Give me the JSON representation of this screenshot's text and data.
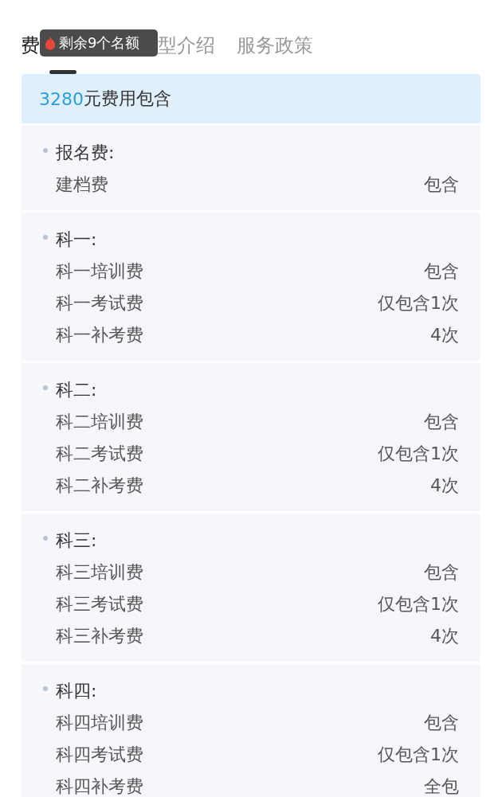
{
  "tabs": [
    {
      "label": "费",
      "selected": true
    },
    {
      "label": "型介绍",
      "selected": false
    },
    {
      "label": "服务政策",
      "selected": false
    }
  ],
  "tooltip": {
    "text": "剩余9个名额"
  },
  "summary": {
    "amount": "3280",
    "text": "元费用包含"
  },
  "sections": [
    {
      "title": "报名费:",
      "items": [
        {
          "name": "建档费",
          "value": "包含"
        }
      ]
    },
    {
      "title": "科一:",
      "items": [
        {
          "name": "科一培训费",
          "value": "包含"
        },
        {
          "name": "科一考试费",
          "value": "仅包含1次"
        },
        {
          "name": "科一补考费",
          "value": "4次"
        }
      ]
    },
    {
      "title": "科二:",
      "items": [
        {
          "name": "科二培训费",
          "value": "包含"
        },
        {
          "name": "科二考试费",
          "value": "仅包含1次"
        },
        {
          "name": "科二补考费",
          "value": "4次"
        }
      ]
    },
    {
      "title": "科三:",
      "items": [
        {
          "name": "科三培训费",
          "value": "包含"
        },
        {
          "name": "科三考试费",
          "value": "仅包含1次"
        },
        {
          "name": "科三补考费",
          "value": "4次"
        }
      ]
    },
    {
      "title": "科四:",
      "items": [
        {
          "name": "科四培训费",
          "value": "包含"
        },
        {
          "name": "科四考试费",
          "value": "仅包含1次"
        },
        {
          "name": "科四补考费",
          "value": "全包"
        }
      ]
    }
  ]
}
